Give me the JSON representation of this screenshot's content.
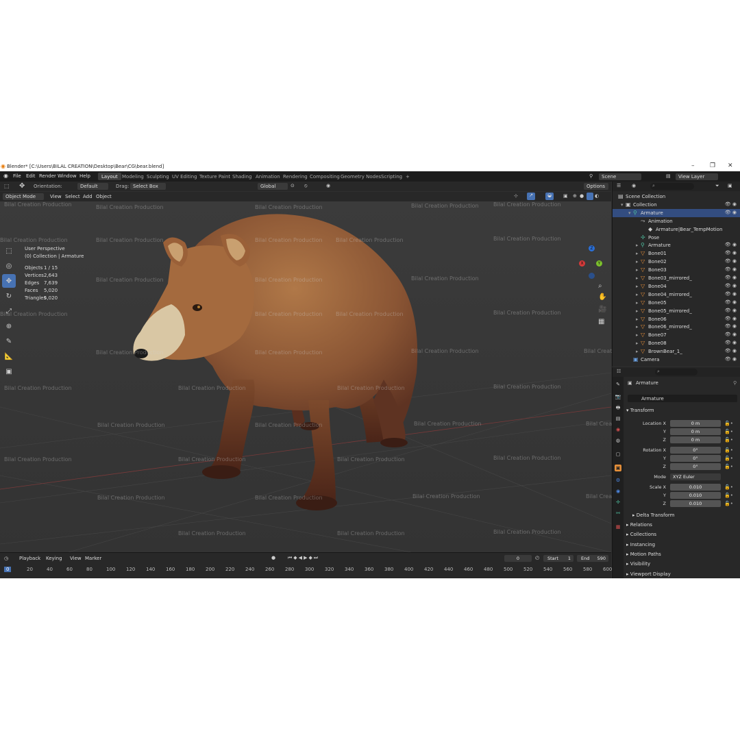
{
  "titlebar": {
    "title": "Blender* [C:\\Users\\BILAL CREATION\\Desktop\\Bear\\CG\\bear.blend]",
    "minimize": "–",
    "maximize": "❐",
    "close": "✕"
  },
  "menu": {
    "items": [
      "File",
      "Edit",
      "Render",
      "Window",
      "Help"
    ]
  },
  "workspaces": {
    "tabs": [
      "Layout",
      "Modeling",
      "Sculpting",
      "UV Editing",
      "Texture Paint",
      "Shading",
      "Animation",
      "Rendering",
      "Compositing",
      "Geometry Nodes",
      "Scripting",
      "+"
    ],
    "active": "Layout"
  },
  "scene": {
    "scene_name": "Scene",
    "view_layer": "View Layer"
  },
  "header": {
    "orientation_label": "Orientation:",
    "orientation_value": "Default",
    "drag_label": "Drag:",
    "drag_value": "Select Box",
    "transform_orientation": "Global",
    "options": "Options"
  },
  "header2": {
    "mode": "Object Mode",
    "view": "View",
    "select": "Select",
    "add": "Add",
    "object": "Object"
  },
  "viewport": {
    "perspective": "User Perspective",
    "collection": "(0) Collection | Armature",
    "stats": [
      {
        "label": "Objects",
        "value": "1 / 15"
      },
      {
        "label": "Vertices",
        "value": "2,643"
      },
      {
        "label": "Edges",
        "value": "7,639"
      },
      {
        "label": "Faces",
        "value": "5,020"
      },
      {
        "label": "Triangles",
        "value": "5,020"
      }
    ],
    "watermark": "Bilal Creation Production",
    "gizmo": {
      "x": "X",
      "y": "Y",
      "z": "Z"
    }
  },
  "outliner": {
    "items": [
      {
        "label": "Scene Collection",
        "indent": 0
      },
      {
        "label": "Collection",
        "indent": 1
      },
      {
        "label": "Armature",
        "indent": 2
      },
      {
        "label": "Animation",
        "indent": 3
      },
      {
        "label": "Armature|Bear_TempMotion",
        "indent": 4
      },
      {
        "label": "Pose",
        "indent": 3
      },
      {
        "label": "Armature",
        "indent": 3
      },
      {
        "label": "Bone01",
        "indent": 3
      },
      {
        "label": "Bone02",
        "indent": 3
      },
      {
        "label": "Bone03",
        "indent": 3
      },
      {
        "label": "Bone03_mirrored_",
        "indent": 3
      },
      {
        "label": "Bone04",
        "indent": 3
      },
      {
        "label": "Bone04_mirrored_",
        "indent": 3
      },
      {
        "label": "Bone05",
        "indent": 3
      },
      {
        "label": "Bone05_mirrored_",
        "indent": 3
      },
      {
        "label": "Bone06",
        "indent": 3
      },
      {
        "label": "Bone06_mirrored_",
        "indent": 3
      },
      {
        "label": "Bone07",
        "indent": 3
      },
      {
        "label": "Bone08",
        "indent": 3
      },
      {
        "label": "BrownBear_1_",
        "indent": 3
      },
      {
        "label": "Camera",
        "indent": 2
      }
    ]
  },
  "properties": {
    "object_name": "Armature",
    "data_name": "Armature",
    "transform": "Transform",
    "location": {
      "label": "Location X",
      "x": "0 m",
      "y": "0 m",
      "z": "0 m"
    },
    "rotation": {
      "label": "Rotation X",
      "x": "0°",
      "y": "0°",
      "z": "0°"
    },
    "mode_label": "Mode",
    "mode_value": "XYZ Euler",
    "scale": {
      "label": "Scale X",
      "x": "0.010",
      "y": "0.010",
      "z": "0.010"
    },
    "axis_y": "Y",
    "axis_z": "Z",
    "sections": [
      "Delta Transform",
      "Relations",
      "Collections",
      "Instancing",
      "Motion Paths",
      "Visibility",
      "Viewport Display"
    ]
  },
  "timeline": {
    "playback": "Playback",
    "keying": "Keying",
    "view": "View",
    "marker": "Marker",
    "current_frame": "0",
    "start_label": "Start",
    "start": "1",
    "end_label": "End",
    "end": "590",
    "frames": [
      "0",
      "20",
      "40",
      "60",
      "80",
      "100",
      "120",
      "140",
      "160",
      "180",
      "200",
      "220",
      "240",
      "260",
      "280",
      "300",
      "320",
      "340",
      "360",
      "380",
      "400",
      "420",
      "440",
      "460",
      "480",
      "500",
      "520",
      "540",
      "560",
      "580",
      "600"
    ]
  }
}
